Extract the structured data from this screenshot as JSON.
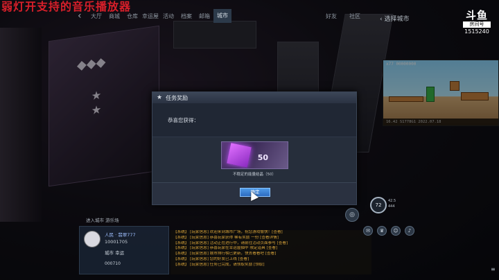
{
  "overlay": {
    "title": "弱灯开支持的音乐播放器"
  },
  "nav": {
    "back_icon": "chevron-left",
    "tabs": [
      "大厅",
      "商城",
      "仓库",
      "幸运屋",
      "活动",
      "档案",
      "邮箱",
      "城市"
    ],
    "active_index": 7,
    "right_items": [
      "好友",
      "社区"
    ],
    "select_city": "选择城市"
  },
  "watermark": {
    "logo": "斗鱼",
    "room_label": "房间号",
    "room_number": "1515240"
  },
  "pip": {
    "hud_text": "x77   00000000",
    "status_bar": "16.42  S1778G1  2022.07.18"
  },
  "modal": {
    "title": "任务奖励",
    "congrats": "恭喜您获得：",
    "reward": {
      "quantity": "50",
      "label": "不稳定的能量结晶（50）"
    },
    "confirm": "确定"
  },
  "userpanel": {
    "room_link": "进入城市 游乐场",
    "name": "人民 · 翡翠777",
    "money": "10001705",
    "stat": "城市  幸运",
    "value": "000710"
  },
  "chat": {
    "lines": [
      "【系统】 [玩家信息] 欢迎来到城市广场，祝您游戏愉快！[查看]",
      "【系统】 [玩家信息] 恭喜玩家获得 稀有奖励 一份 [查看详情]",
      "【系统】 [玩家信息] 活动正在进行中，请前往活动页面参与 [查看]",
      "【系统】 [玩家信息] 恭喜玩家在幸运屋抽中 限定道具 [查看]",
      "【系统】 [玩家信息] 城市排行榜已更新，快去看看吧 [查看]",
      "【系统】 [玩家信息] 您的好友已上线 [查看]",
      "【系统】 [玩家信息] 任务已完成，请领取奖励 [领取]"
    ]
  },
  "hud": {
    "speed": "72",
    "speed_info_1": "42.5",
    "speed_info_2": "444",
    "icons": [
      "globe-icon",
      "chat-icon",
      "trophy-icon",
      "people-icon",
      "bell-icon"
    ]
  }
}
